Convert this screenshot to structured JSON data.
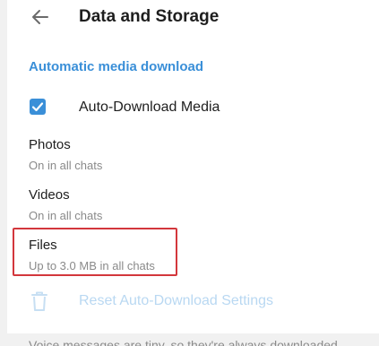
{
  "header": {
    "title": "Data and Storage",
    "back_icon": "arrow-left-icon"
  },
  "section": {
    "title": "Automatic media download"
  },
  "auto_download": {
    "label": "Auto-Download Media",
    "checked": true,
    "accent_color": "#3a8fd8"
  },
  "media_types": [
    {
      "name": "Photos",
      "value": "On in all chats"
    },
    {
      "name": "Videos",
      "value": "On in all chats"
    },
    {
      "name": "Files",
      "value": "Up to 3.0 MB in all chats"
    }
  ],
  "highlight_color": "#d3373c",
  "reset": {
    "label": "Reset Auto-Download Settings",
    "icon": "trash-icon",
    "disabled": true
  },
  "footer_note": "Voice messages are tiny, so they're always downloaded"
}
